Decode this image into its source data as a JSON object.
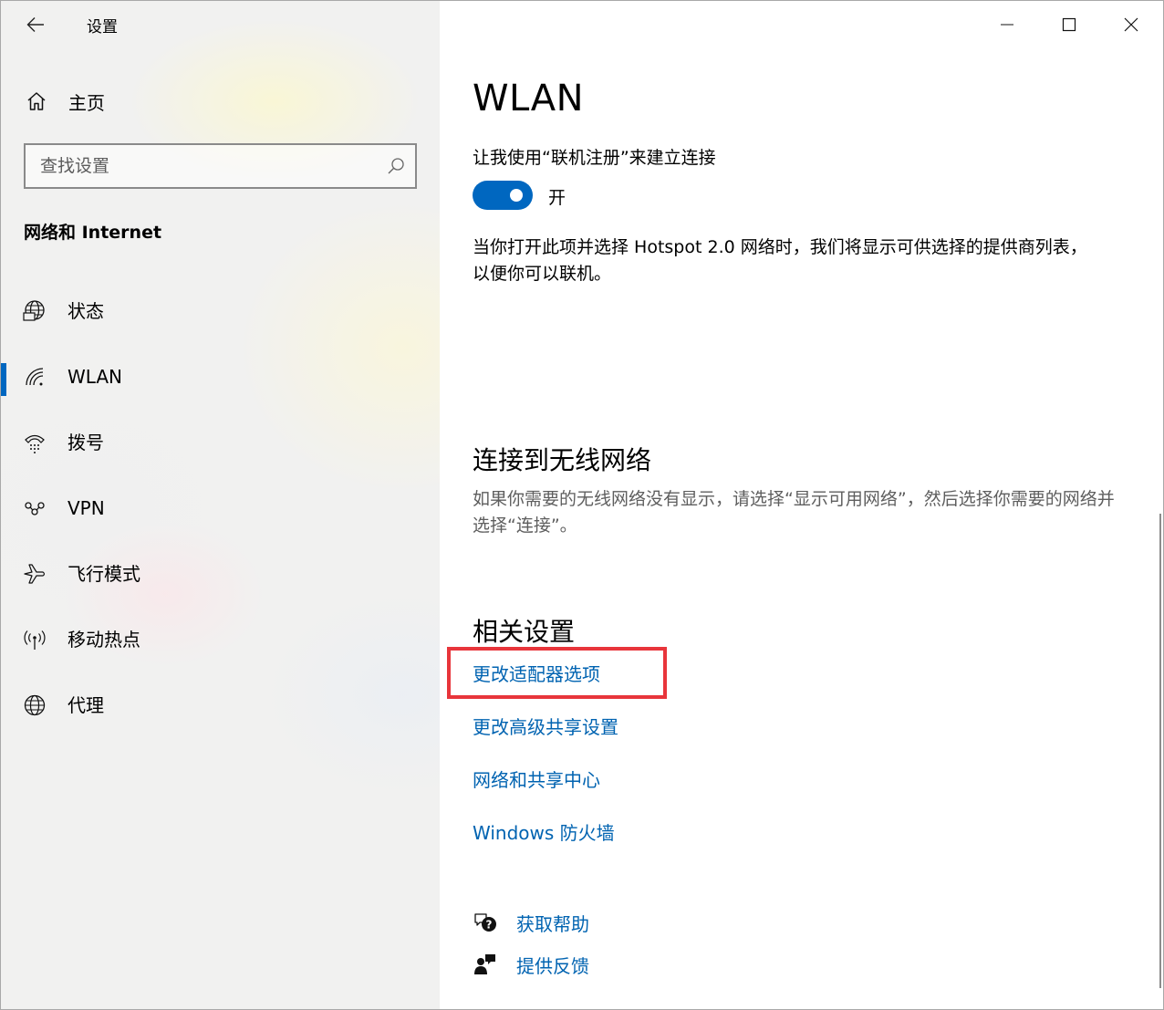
{
  "app": {
    "title": "设置"
  },
  "sidebar": {
    "home_label": "主页",
    "search_placeholder": "查找设置",
    "section_title": "网络和 Internet",
    "items": [
      {
        "label": "状态",
        "icon": "status-globe-icon",
        "selected": false
      },
      {
        "label": "WLAN",
        "icon": "wifi-icon",
        "selected": true
      },
      {
        "label": "拨号",
        "icon": "dial-up-icon",
        "selected": false
      },
      {
        "label": "VPN",
        "icon": "vpn-icon",
        "selected": false
      },
      {
        "label": "飞行模式",
        "icon": "airplane-icon",
        "selected": false
      },
      {
        "label": "移动热点",
        "icon": "hotspot-icon",
        "selected": false
      },
      {
        "label": "代理",
        "icon": "globe-icon",
        "selected": false
      }
    ]
  },
  "main": {
    "title": "WLAN",
    "online_signup": {
      "label": "让我使用“联机注册”来建立连接",
      "toggle_state": "开",
      "toggle_on": true,
      "description": "当你打开此项并选择 Hotspot 2.0 网络时，我们将显示可供选择的提供商列表，以便你可以联机。"
    },
    "connect": {
      "heading": "连接到无线网络",
      "description": "如果你需要的无线网络没有显示，请选择“显示可用网络”，然后选择你需要的网络并选择“连接”。"
    },
    "related": {
      "heading": "相关设置",
      "links": [
        "更改适配器选项",
        "更改高级共享设置",
        "网络和共享中心",
        "Windows 防火墙"
      ]
    },
    "help": {
      "get_help": "获取帮助",
      "feedback": "提供反馈"
    }
  },
  "colors": {
    "accent": "#0067c0",
    "link": "#0063b1",
    "highlight": "#e8353b"
  }
}
